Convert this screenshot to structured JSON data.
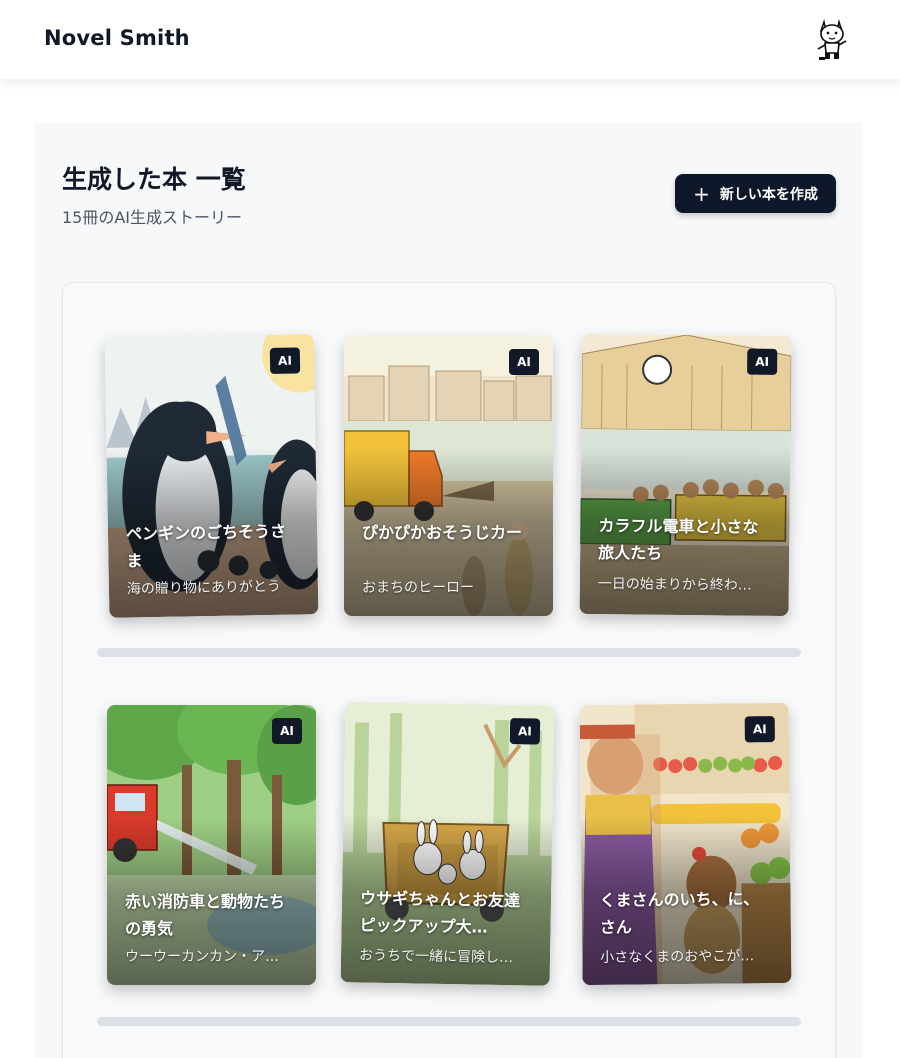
{
  "header": {
    "brand": "Novel Smith",
    "avatar_icon": "cat-mascot-icon"
  },
  "page": {
    "title": "生成した本 一覧",
    "subtitle": "15冊のAI生成ストーリー",
    "new_book_button": "新しい本を作成",
    "new_book_icon": "plus-icon"
  },
  "books": [
    {
      "title": "ペンギンのごちそうさま",
      "description": "海の贈り物にありがとう",
      "badge": "AI"
    },
    {
      "title": "ぴかぴかおそうじカー",
      "description": "おまちのヒーロー",
      "badge": "AI"
    },
    {
      "title": "カラフル電車と小さな旅人たち",
      "description": "一日の始まりから終わ…",
      "badge": "AI"
    },
    {
      "title": "赤い消防車と動物たちの勇気",
      "description": "ウーウーカンカン・ア…",
      "badge": "AI"
    },
    {
      "title": "ウサギちゃんとお友達ピックアップ大…",
      "description": "おうちで一緒に冒険し…",
      "badge": "AI"
    },
    {
      "title": "くまさんのいち、に、さん",
      "description": "小さなくまのおやこが…",
      "badge": "AI"
    }
  ],
  "colors": {
    "primary_button": "#0f172a",
    "badge": "#111827"
  }
}
